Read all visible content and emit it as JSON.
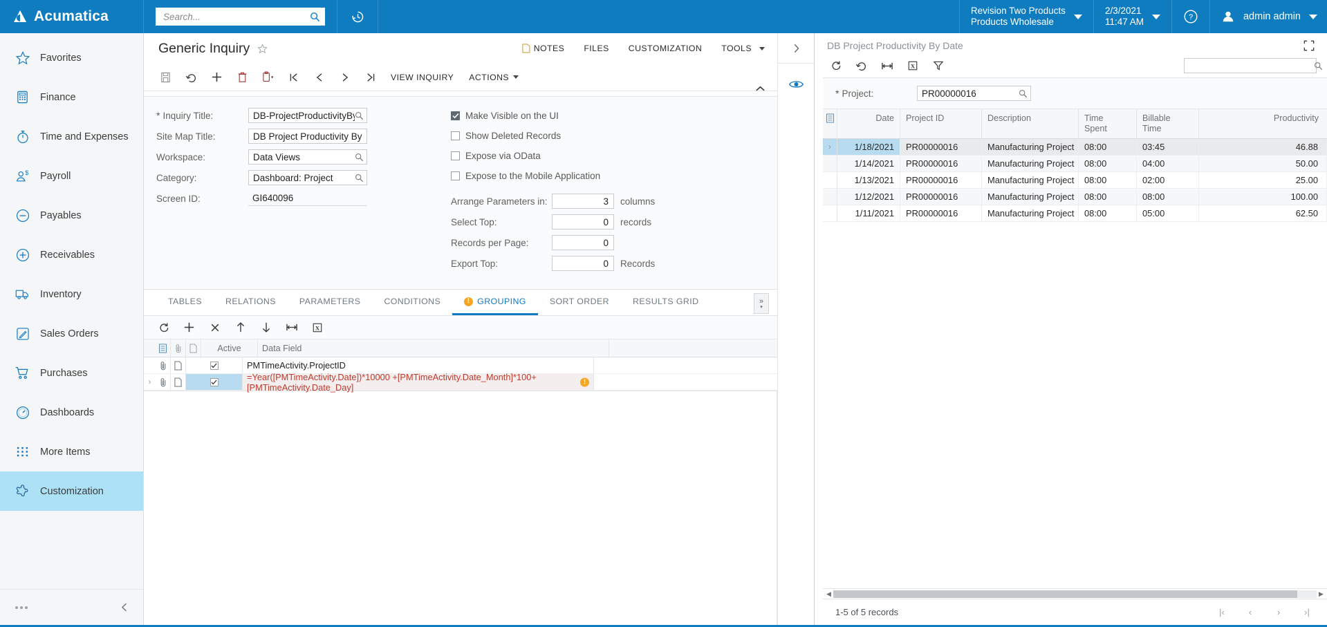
{
  "topbar": {
    "brand": "Acumatica",
    "brand_logo_icon": "acumatica-logo-icon",
    "search_placeholder": "Search...",
    "search_value": "",
    "search_icon": "search-icon",
    "recent_icon": "recent-history-icon",
    "company": {
      "line1": "Revision Two Products",
      "line2": "Products Wholesale"
    },
    "datetime": {
      "date": "2/3/2021",
      "time": "11:47 AM"
    },
    "help_icon": "help-circle-icon",
    "user": {
      "name": "admin admin",
      "avatar_icon": "user-avatar-icon"
    }
  },
  "sidebar": {
    "items": [
      {
        "label": "Favorites",
        "icon": "star-icon",
        "active": false
      },
      {
        "label": "Finance",
        "icon": "calculator-icon",
        "active": false
      },
      {
        "label": "Time and Expenses",
        "icon": "stopwatch-icon",
        "active": false
      },
      {
        "label": "Payroll",
        "icon": "person-dollar-icon",
        "active": false
      },
      {
        "label": "Payables",
        "icon": "minus-circle-icon",
        "active": false
      },
      {
        "label": "Receivables",
        "icon": "plus-circle-icon",
        "active": false
      },
      {
        "label": "Inventory",
        "icon": "truck-icon",
        "active": false
      },
      {
        "label": "Sales Orders",
        "icon": "pencil-square-icon",
        "active": false
      },
      {
        "label": "Purchases",
        "icon": "shopping-cart-icon",
        "active": false
      },
      {
        "label": "Dashboards",
        "icon": "gauge-icon",
        "active": false
      },
      {
        "label": "More Items",
        "icon": "grid-dots-icon",
        "active": false
      },
      {
        "label": "Customization",
        "icon": "puzzle-icon",
        "active": true
      }
    ],
    "footer": {
      "more_icon": "ellipsis-icon",
      "collapse_icon": "chevron-left-icon"
    }
  },
  "page": {
    "title": "Generic Inquiry",
    "favorite_icon": "star-outline-icon",
    "head_links": [
      {
        "label": "NOTES",
        "icon": "note-icon"
      },
      {
        "label": "FILES",
        "icon": ""
      },
      {
        "label": "CUSTOMIZATION",
        "icon": ""
      },
      {
        "label": "TOOLS",
        "icon": "",
        "caret": true
      }
    ],
    "toolbar": {
      "icons": [
        {
          "name": "save-icon"
        },
        {
          "name": "undo-icon"
        },
        {
          "name": "add-new-icon"
        },
        {
          "name": "delete-icon"
        },
        {
          "name": "copy-paste-icon",
          "caret": true
        },
        {
          "name": "first-record-icon"
        },
        {
          "name": "previous-record-icon"
        },
        {
          "name": "next-record-icon"
        },
        {
          "name": "last-record-icon"
        }
      ],
      "view_inquiry_label": "VIEW INQUIRY",
      "actions_label": "ACTIONS"
    }
  },
  "form": {
    "collapse_icon": "chevron-up-icon",
    "fields": [
      {
        "label": "Inquiry Title:",
        "value": "DB-ProjectProductivityByDate",
        "required": true,
        "lookup": true
      },
      {
        "label": "Site Map Title:",
        "value": "DB Project Productivity By Date",
        "required": false,
        "lookup": false
      },
      {
        "label": "Workspace:",
        "value": "Data Views",
        "required": false,
        "lookup": true
      },
      {
        "label": "Category:",
        "value": "Dashboard: Project",
        "required": false,
        "lookup": true
      },
      {
        "label": "Screen ID:",
        "value": "GI640096",
        "required": false,
        "lookup": false,
        "plain": true
      }
    ],
    "checkboxes": [
      {
        "label": "Make Visible on the UI",
        "checked": true
      },
      {
        "label": "Show Deleted Records",
        "checked": false
      },
      {
        "label": "Expose via OData",
        "checked": false
      },
      {
        "label": "Expose to the Mobile Application",
        "checked": false
      }
    ],
    "numbers": [
      {
        "label": "Arrange Parameters in:",
        "value": "3",
        "suffix": "columns"
      },
      {
        "label": "Select Top:",
        "value": "0",
        "suffix": "records"
      },
      {
        "label": "Records per Page:",
        "value": "0",
        "suffix": ""
      },
      {
        "label": "Export Top:",
        "value": "0",
        "suffix": "Records"
      }
    ]
  },
  "tabs": {
    "items": [
      {
        "label": "TABLES",
        "active": false,
        "warning": false
      },
      {
        "label": "RELATIONS",
        "active": false,
        "warning": false
      },
      {
        "label": "PARAMETERS",
        "active": false,
        "warning": false
      },
      {
        "label": "CONDITIONS",
        "active": false,
        "warning": false
      },
      {
        "label": "GROUPING",
        "active": true,
        "warning": true
      },
      {
        "label": "SORT ORDER",
        "active": false,
        "warning": false
      },
      {
        "label": "RESULTS GRID",
        "active": false,
        "warning": false
      }
    ],
    "overflow_icon": "chevron-double-right-icon"
  },
  "grouping_grid": {
    "toolbar_icons": [
      {
        "name": "refresh-icon"
      },
      {
        "name": "add-row-icon"
      },
      {
        "name": "delete-row-icon"
      },
      {
        "name": "move-up-icon"
      },
      {
        "name": "move-down-icon"
      },
      {
        "name": "fit-columns-icon"
      },
      {
        "name": "export-excel-icon"
      }
    ],
    "columns": [
      {
        "key": "grid_settings",
        "label": "",
        "icon": "grid-settings-icon"
      },
      {
        "key": "attachment",
        "label": "",
        "icon": "paperclip-icon"
      },
      {
        "key": "note",
        "label": "",
        "icon": "note-page-icon"
      },
      {
        "key": "active",
        "label": "Active"
      },
      {
        "key": "data_field",
        "label": "Data Field"
      }
    ],
    "rows": [
      {
        "selected": false,
        "active": true,
        "data_field": "PMTimeActivity.ProjectID",
        "formula": false,
        "warning": false,
        "attachment_icon": "paperclip-icon",
        "note_icon": "note-page-icon"
      },
      {
        "selected": true,
        "active": true,
        "data_field": "=Year([PMTimeActivity.Date])*10000 +[PMTimeActivity.Date_Month]*100+[PMTimeActivity.Date_Day]",
        "formula": true,
        "warning": true,
        "attachment_icon": "paperclip-icon",
        "note_icon": "note-page-icon"
      }
    ]
  },
  "rail": {
    "buttons": [
      {
        "name": "expand-panel-button",
        "icon": "chevron-right-icon"
      },
      {
        "name": "preview-toggle-button",
        "icon": "eye-icon"
      }
    ]
  },
  "preview": {
    "title": "DB Project Productivity By Date",
    "expand_icon": "fullscreen-icon",
    "toolbar_icons": [
      {
        "name": "refresh-icon"
      },
      {
        "name": "undo-icon"
      },
      {
        "name": "fit-columns-icon"
      },
      {
        "name": "export-excel-icon"
      },
      {
        "name": "filter-icon"
      }
    ],
    "search_value": "",
    "search_icon": "search-icon",
    "project_field": {
      "label": "Project:",
      "value": "PR00000016",
      "required": true,
      "lookup": true
    },
    "grid": {
      "columns": [
        {
          "label": "",
          "icon": "grid-settings-icon",
          "align": "left"
        },
        {
          "label": "Date",
          "align": "right"
        },
        {
          "label": "Project ID",
          "align": "left"
        },
        {
          "label": "Description",
          "align": "left"
        },
        {
          "label": "Time\nSpent",
          "align": "left"
        },
        {
          "label": "Billable\nTime",
          "align": "left"
        },
        {
          "label": "Productivity",
          "align": "right"
        }
      ],
      "column_labels": {
        "date": "Date",
        "project_id": "Project ID",
        "description": "Description",
        "time_spent_l1": "Time",
        "time_spent_l2": "Spent",
        "billable_time_l1": "Billable",
        "billable_time_l2": "Time",
        "productivity": "Productivity"
      },
      "rows": [
        {
          "date": "1/18/2021",
          "project_id": "PR00000016",
          "description": "Manufacturing Project",
          "time_spent": "08:00",
          "billable_time": "03:45",
          "productivity": "46.88",
          "selected": true
        },
        {
          "date": "1/14/2021",
          "project_id": "PR00000016",
          "description": "Manufacturing Project",
          "time_spent": "08:00",
          "billable_time": "04:00",
          "productivity": "50.00",
          "selected": false
        },
        {
          "date": "1/13/2021",
          "project_id": "PR00000016",
          "description": "Manufacturing Project",
          "time_spent": "08:00",
          "billable_time": "02:00",
          "productivity": "25.00",
          "selected": false
        },
        {
          "date": "1/12/2021",
          "project_id": "PR00000016",
          "description": "Manufacturing Project",
          "time_spent": "08:00",
          "billable_time": "08:00",
          "productivity": "100.00",
          "selected": false
        },
        {
          "date": "1/11/2021",
          "project_id": "PR00000016",
          "description": "Manufacturing Project",
          "time_spent": "08:00",
          "billable_time": "05:00",
          "productivity": "62.50",
          "selected": false
        }
      ]
    },
    "footer": {
      "record_count": "1-5 of 5 records",
      "pager": [
        {
          "name": "first-page-button",
          "glyph": "|‹"
        },
        {
          "name": "previous-page-button",
          "glyph": "‹"
        },
        {
          "name": "next-page-button",
          "glyph": "›"
        },
        {
          "name": "last-page-button",
          "glyph": "›|"
        }
      ]
    }
  },
  "colors": {
    "brand_blue": "#0f7cc0",
    "accent_blue": "#1079c3",
    "active_nav": "#ace1f6",
    "selection": "#b8dbf0",
    "warning": "#f5a623",
    "formula_red": "#c0392b"
  }
}
